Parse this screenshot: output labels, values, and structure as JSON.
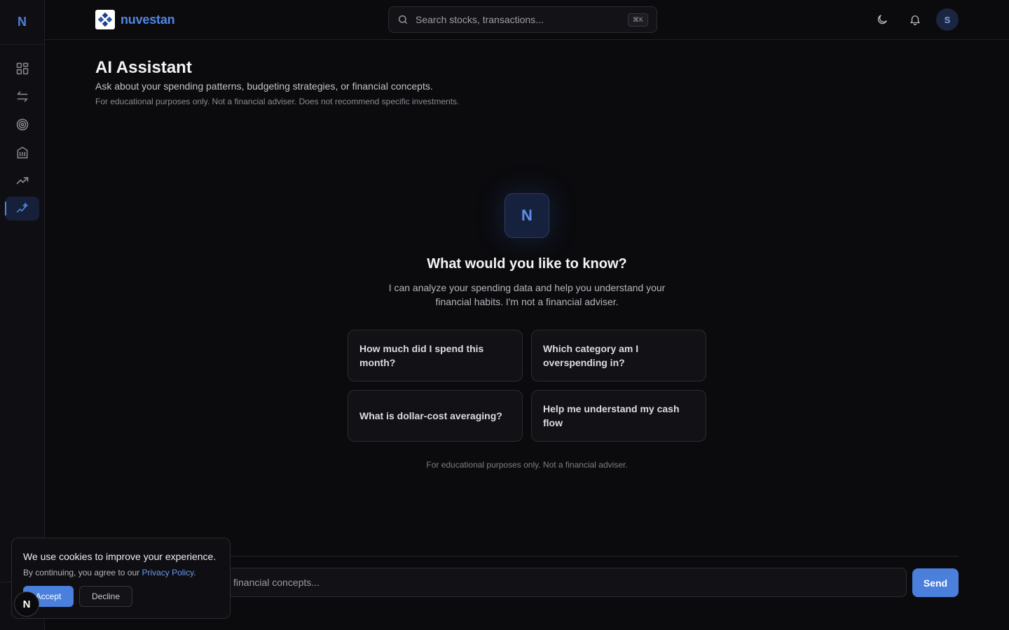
{
  "sidebar": {
    "logo": "N",
    "items": [
      {
        "name": "dashboard",
        "icon": "grid-icon"
      },
      {
        "name": "transactions",
        "icon": "arrows-swap-icon"
      },
      {
        "name": "goals",
        "icon": "target-icon"
      },
      {
        "name": "institutions",
        "icon": "building-icon"
      },
      {
        "name": "investments",
        "icon": "trending-up-icon"
      },
      {
        "name": "ai-assistant",
        "icon": "sparkles-icon",
        "active": true
      }
    ]
  },
  "header": {
    "brand": "nuvestan",
    "search_placeholder": "Search stocks, transactions...",
    "shortcut": "⌘K",
    "avatar_initial": "S"
  },
  "page": {
    "title": "AI Assistant",
    "subtitle": "Ask about your spending patterns, budgeting strategies, or financial concepts.",
    "disclaimer": "For educational purposes only. Not a financial adviser. Does not recommend specific investments."
  },
  "hero": {
    "badge": "N",
    "title": "What would you like to know?",
    "description": "I can analyze your spending data and help you understand your financial habits. I'm not a financial adviser."
  },
  "suggestions": [
    "How much did I spend this month?",
    "Which category am I overspending in?",
    "What is dollar-cost averaging?",
    "Help me understand my cash flow"
  ],
  "footer_disclaimer": "For educational purposes only. Not a financial adviser.",
  "composer": {
    "placeholder": "financial concepts...",
    "send_label": "Send"
  },
  "cookie": {
    "title": "We use cookies to improve your experience.",
    "text": "By continuing, you agree to our",
    "link": "Privacy Policy",
    "accept": "Accept",
    "decline": "Decline"
  },
  "floating_badge": "N",
  "colors": {
    "accent": "#4a7fdc",
    "background": "#0b0b0e"
  }
}
